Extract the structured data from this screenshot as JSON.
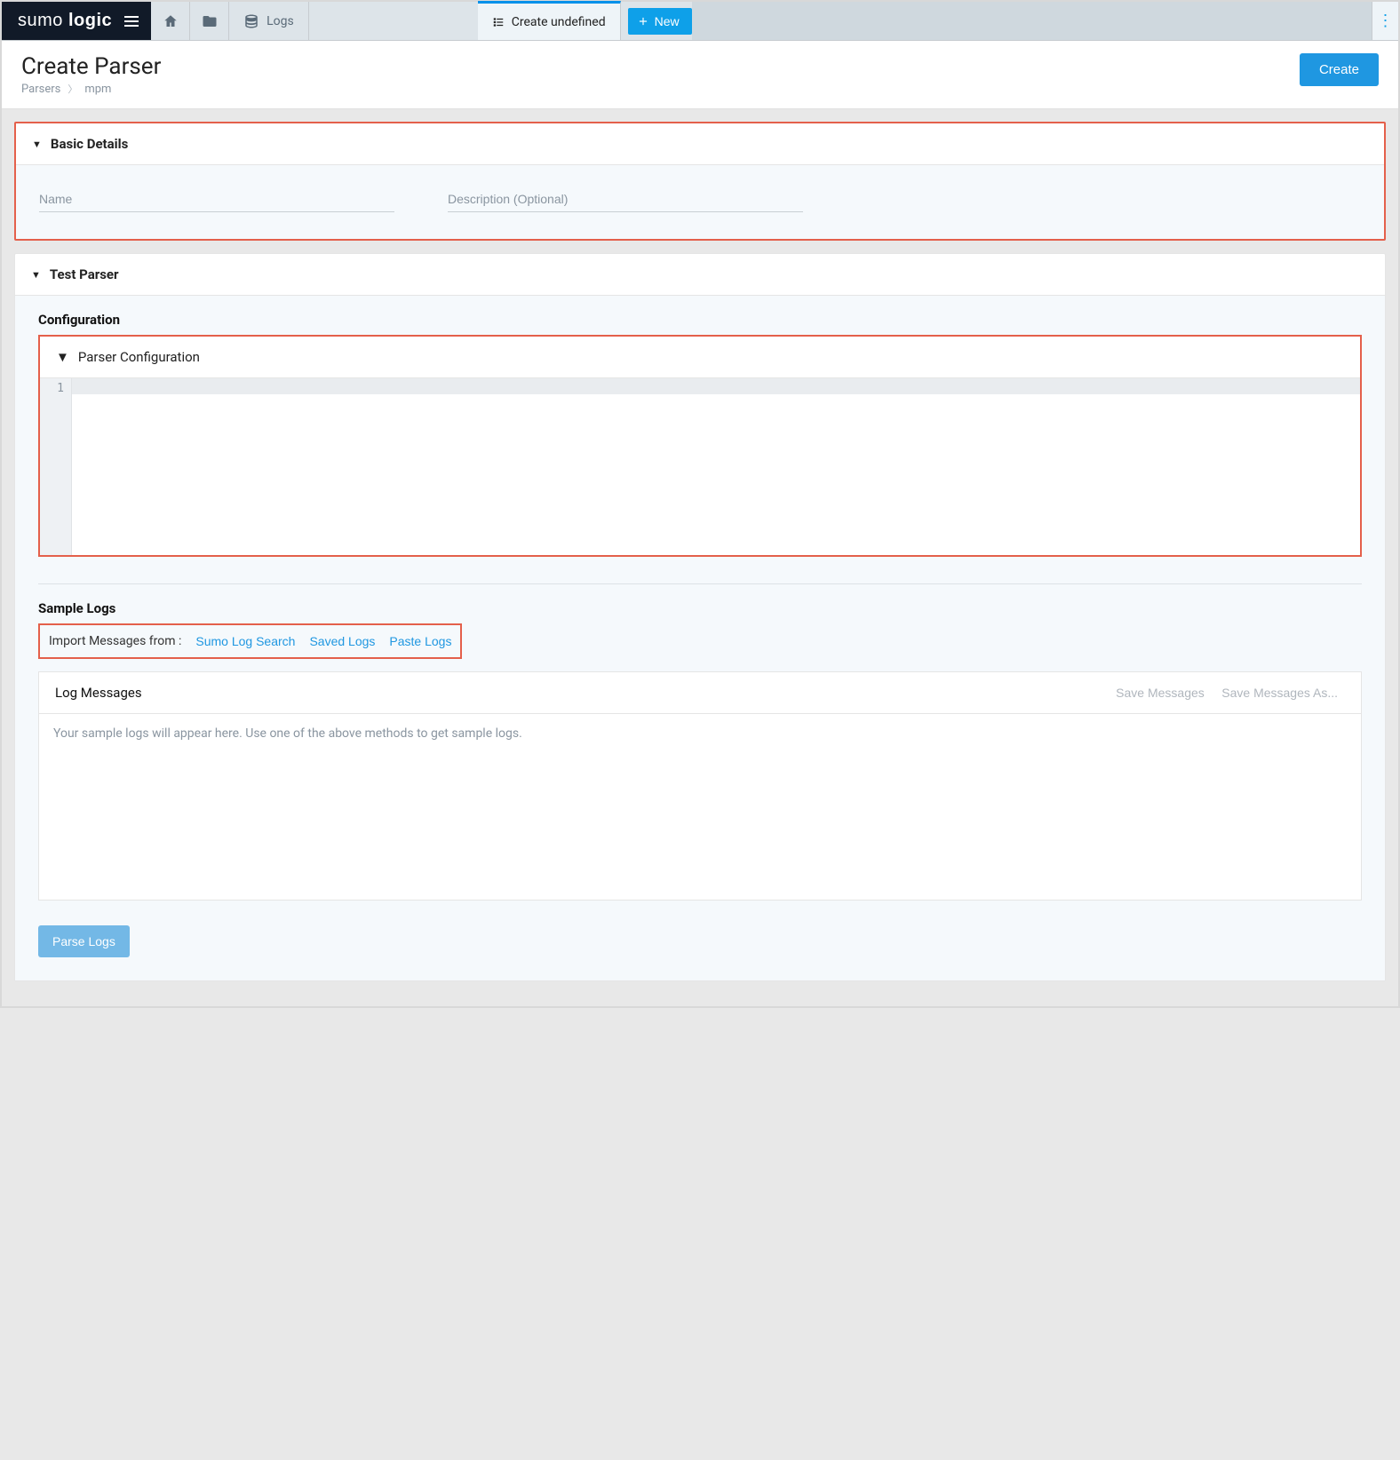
{
  "brand": {
    "part1": "sumo",
    "part2": "logic"
  },
  "tabs": {
    "logs": {
      "label": "Logs"
    },
    "create": {
      "label": "Create undefined"
    },
    "newBtn": {
      "label": "New"
    }
  },
  "page": {
    "title": "Create Parser",
    "breadcrumb": {
      "root": "Parsers",
      "leaf": "mpm"
    },
    "createBtn": "Create"
  },
  "basicDetails": {
    "heading": "Basic Details",
    "namePlaceholder": "Name",
    "descPlaceholder": "Description (Optional)"
  },
  "testParser": {
    "heading": "Test Parser",
    "configHeading": "Configuration",
    "parserConfigHeading": "Parser Configuration",
    "gutterLine": "1"
  },
  "sampleLogs": {
    "heading": "Sample Logs",
    "importLabel": "Import Messages from :",
    "links": {
      "search": "Sumo Log Search",
      "saved": "Saved Logs",
      "paste": "Paste Logs"
    }
  },
  "logMessages": {
    "heading": "Log Messages",
    "saveBtn": "Save Messages",
    "saveAsBtn": "Save Messages As...",
    "placeholder": "Your sample logs will appear here. Use one of the above methods to get sample logs."
  },
  "parseBtn": "Parse Logs"
}
